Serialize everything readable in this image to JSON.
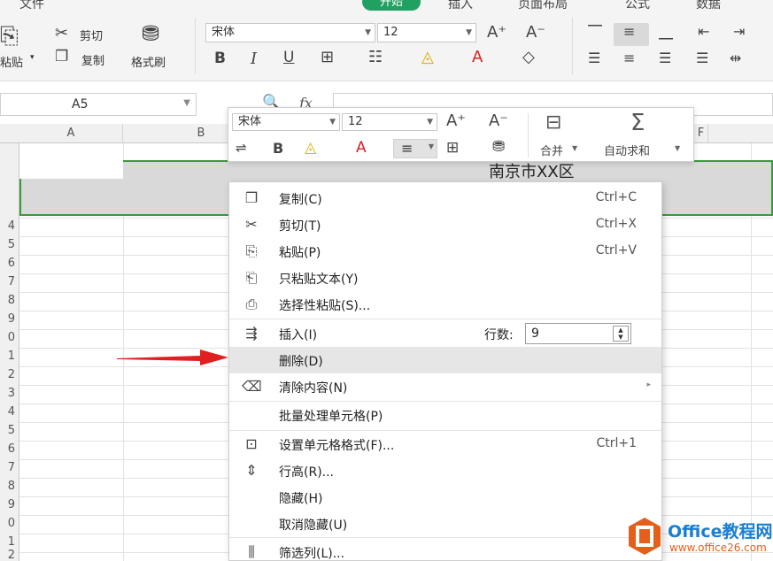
{
  "ribbon": {
    "tabs": [
      {
        "label": "文件"
      },
      {
        "label": "开始"
      },
      {
        "label": "插入"
      },
      {
        "label": "页面布局"
      },
      {
        "label": "公式"
      },
      {
        "label": "数据"
      }
    ],
    "paste_label": "粘贴",
    "cut_label": "剪切",
    "copy_label": "复制",
    "format_painter_label": "格式刷",
    "font_name": "宋体",
    "font_size": "12"
  },
  "formula_bar": {
    "cell_ref": "A5",
    "fx_label": "fx"
  },
  "columns": [
    "A",
    "B",
    "F"
  ],
  "rows": [
    "",
    "",
    "",
    "4",
    "5",
    "6",
    "7",
    "8",
    "9",
    "0",
    "1",
    "2",
    "3",
    "4",
    "5",
    "6",
    "7",
    "8",
    "9",
    "0",
    "1",
    "2"
  ],
  "cell_text": "南京市XX区",
  "mini_toolbar": {
    "font_name": "宋体",
    "font_size": "12",
    "merge_label": "合并",
    "autosum_label": "自动求和"
  },
  "context_menu": {
    "items": [
      {
        "label": "复制(C)",
        "shortcut": "Ctrl+C"
      },
      {
        "label": "剪切(T)",
        "shortcut": "Ctrl+X"
      },
      {
        "label": "粘贴(P)",
        "shortcut": "Ctrl+V"
      },
      {
        "label": "只粘贴文本(Y)",
        "shortcut": ""
      },
      {
        "label": "选择性粘贴(S)...",
        "shortcut": ""
      },
      {
        "label": "插入(I)",
        "shortcut": ""
      },
      {
        "label": "删除(D)",
        "shortcut": ""
      },
      {
        "label": "清除内容(N)",
        "shortcut": ""
      },
      {
        "label": "批量处理单元格(P)",
        "shortcut": ""
      },
      {
        "label": "设置单元格格式(F)...",
        "shortcut": "Ctrl+1"
      },
      {
        "label": "行高(R)...",
        "shortcut": ""
      },
      {
        "label": "隐藏(H)",
        "shortcut": ""
      },
      {
        "label": "取消隐藏(U)",
        "shortcut": ""
      },
      {
        "label": "筛选列(L)...",
        "shortcut": ""
      }
    ],
    "rows_count_label": "行数:",
    "rows_count_value": "9"
  },
  "watermark": {
    "title": "Office教程网",
    "url": "www.office26.com"
  },
  "colors": {
    "accent": "#20a162",
    "selection_border": "#3a9a3a",
    "arrow": "#e02020"
  }
}
